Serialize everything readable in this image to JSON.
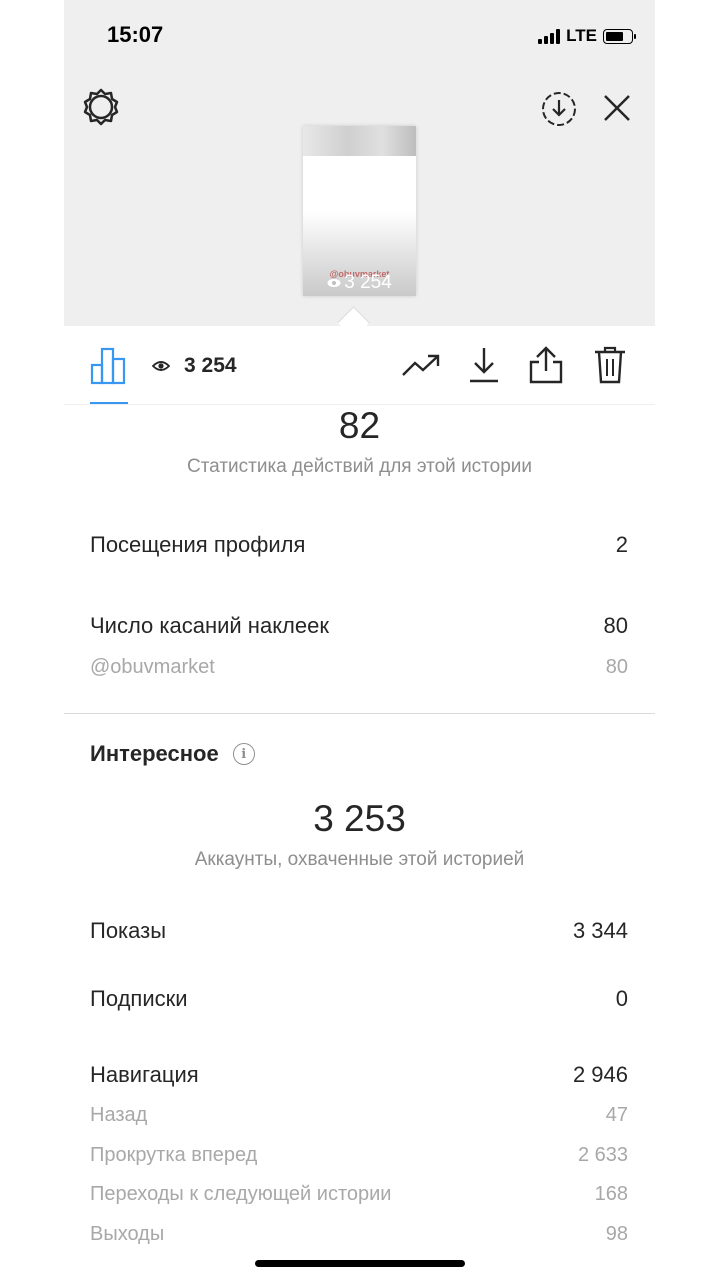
{
  "status_bar": {
    "time": "15:07",
    "network": "LTE"
  },
  "header": {
    "settings_icon": "gear-icon",
    "download_icon": "download-circle-icon",
    "close_icon": "close-icon"
  },
  "story_thumbnail": {
    "handle": "@obuvmarket",
    "views": "3 254"
  },
  "toolbar": {
    "stats_icon": "bar-chart-icon",
    "views": "3 254",
    "trend_icon": "trend-up-icon",
    "save_icon": "download-icon",
    "share_icon": "share-icon",
    "delete_icon": "trash-icon"
  },
  "actions": {
    "total": "82",
    "label": "Статистика действий для этой истории",
    "rows": [
      {
        "label": "Посещения профиля",
        "value": "2"
      },
      {
        "label": "Число касаний наклеек",
        "value": "80"
      }
    ],
    "sticker_rows": [
      {
        "label": "@obuvmarket",
        "value": "80"
      }
    ]
  },
  "discovery": {
    "title": "Интересное",
    "total": "3 253",
    "label": "Аккаунты, охваченные этой историей",
    "rows": [
      {
        "label": "Показы",
        "value": "3 344"
      },
      {
        "label": "Подписки",
        "value": "0"
      },
      {
        "label": "Навигация",
        "value": "2 946"
      }
    ],
    "navigation_rows": [
      {
        "label": "Назад",
        "value": "47"
      },
      {
        "label": "Прокрутка вперед",
        "value": "2 633"
      },
      {
        "label": "Переходы к следующей истории",
        "value": "168"
      },
      {
        "label": "Выходы",
        "value": "98"
      }
    ]
  },
  "colors": {
    "accent": "#3897f0",
    "muted_text": "#8e8e8e",
    "header_bg": "#efefef"
  }
}
